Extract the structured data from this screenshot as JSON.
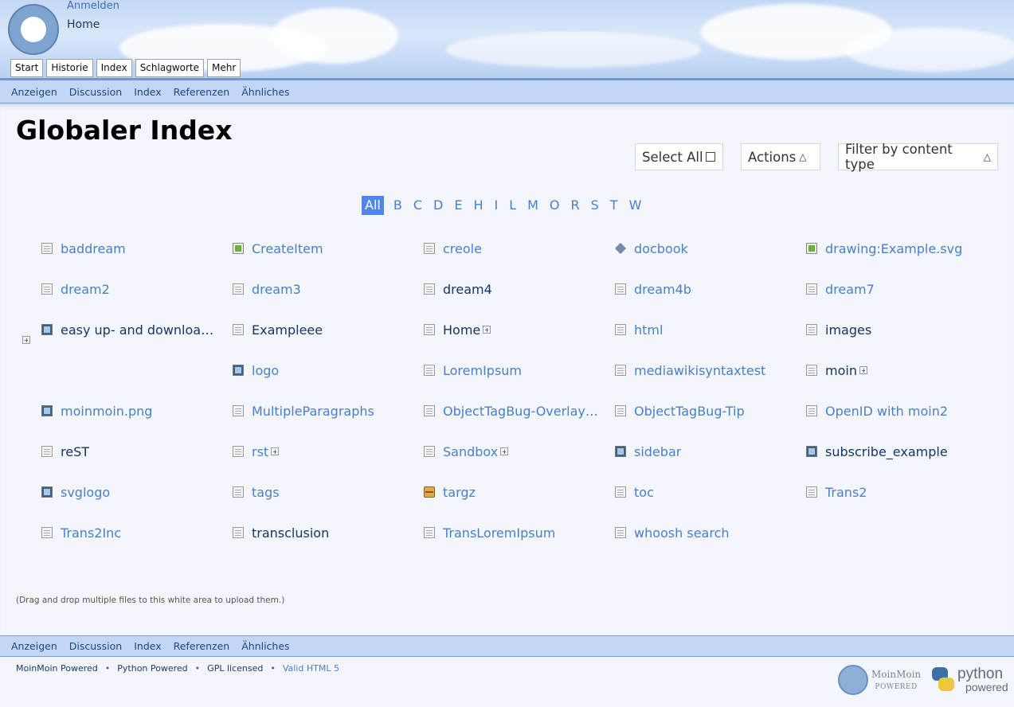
{
  "header": {
    "login_label": "Anmelden",
    "home_title": "Home",
    "buttons": [
      "Start",
      "Historie",
      "Index",
      "Schlagworte",
      "Mehr"
    ]
  },
  "subnav": [
    "Anzeigen",
    "Discussion",
    "Index",
    "Referenzen",
    "Ähnliches"
  ],
  "page": {
    "title": "Globaler Index",
    "select_all_label": "Select All",
    "actions_label": "Actions",
    "filter_label": "Filter by content type",
    "drag_hint": "(Drag and drop multiple files to this white area to upload them.)"
  },
  "alphabet": [
    "All",
    "B",
    "C",
    "D",
    "E",
    "H",
    "I",
    "L",
    "M",
    "O",
    "R",
    "S",
    "T",
    "W"
  ],
  "alphabet_active": "All",
  "items": [
    {
      "name": "baddream",
      "icon": "doc-icon",
      "kind": "doc",
      "visited": false,
      "expand": false
    },
    {
      "name": "CreateItem",
      "icon": "drawing-icon",
      "kind": "draw",
      "visited": false,
      "expand": false
    },
    {
      "name": "creole",
      "icon": "doc-icon",
      "kind": "doc",
      "visited": false,
      "expand": false
    },
    {
      "name": "docbook",
      "icon": "docbook-icon",
      "kind": "docbook",
      "visited": false,
      "expand": false
    },
    {
      "name": "drawing:Example.svg",
      "icon": "drawing-icon",
      "kind": "draw",
      "visited": false,
      "expand": false
    },
    {
      "name": "dream2",
      "icon": "doc-icon",
      "kind": "doc",
      "visited": false,
      "expand": false
    },
    {
      "name": "dream3",
      "icon": "doc-icon",
      "kind": "doc",
      "visited": false,
      "expand": false
    },
    {
      "name": "dream4",
      "icon": "doc-icon",
      "kind": "doc",
      "visited": true,
      "expand": false
    },
    {
      "name": "dream4b",
      "icon": "doc-icon",
      "kind": "doc",
      "visited": false,
      "expand": false
    },
    {
      "name": "dream7",
      "icon": "doc-icon",
      "kind": "doc",
      "visited": false,
      "expand": false
    },
    {
      "name": "easy up- and downloa…",
      "icon": "image-icon",
      "kind": "img",
      "visited": true,
      "expand": false
    },
    {
      "name": "Exampleee",
      "icon": "doc-icon",
      "kind": "doc",
      "visited": true,
      "expand": false
    },
    {
      "name": "Home",
      "icon": "doc-icon",
      "kind": "doc",
      "visited": true,
      "expand": true
    },
    {
      "name": "html",
      "icon": "doc-icon",
      "kind": "doc",
      "visited": false,
      "expand": false
    },
    {
      "name": "images",
      "icon": "doc-icon",
      "kind": "doc",
      "visited": true,
      "expand": false
    },
    {
      "name": "",
      "icon": "",
      "kind": "",
      "visited": false,
      "expand": false
    },
    {
      "name": "logo",
      "icon": "image-icon",
      "kind": "img",
      "visited": false,
      "expand": false
    },
    {
      "name": "LoremIpsum",
      "icon": "doc-icon",
      "kind": "doc",
      "visited": false,
      "expand": false
    },
    {
      "name": "mediawikisyntaxtest",
      "icon": "doc-icon",
      "kind": "doc",
      "visited": false,
      "expand": false
    },
    {
      "name": "moin",
      "icon": "doc-icon",
      "kind": "doc",
      "visited": true,
      "expand": true
    },
    {
      "name": "moinmoin.png",
      "icon": "image-icon",
      "kind": "img",
      "visited": false,
      "expand": false
    },
    {
      "name": "MultipleParagraphs",
      "icon": "doc-icon",
      "kind": "doc",
      "visited": false,
      "expand": false
    },
    {
      "name": "ObjectTagBug-Overlay…",
      "icon": "doc-icon",
      "kind": "doc",
      "visited": false,
      "expand": false
    },
    {
      "name": "ObjectTagBug-Tip",
      "icon": "doc-icon",
      "kind": "doc",
      "visited": false,
      "expand": false
    },
    {
      "name": "OpenID with moin2",
      "icon": "doc-icon",
      "kind": "doc",
      "visited": false,
      "expand": false
    },
    {
      "name": "reST",
      "icon": "doc-icon",
      "kind": "doc",
      "visited": true,
      "expand": false
    },
    {
      "name": "rst",
      "icon": "doc-icon",
      "kind": "doc",
      "visited": false,
      "expand": true
    },
    {
      "name": "Sandbox",
      "icon": "doc-icon",
      "kind": "doc",
      "visited": false,
      "expand": true
    },
    {
      "name": "sidebar",
      "icon": "image-icon",
      "kind": "img",
      "visited": false,
      "expand": false
    },
    {
      "name": "subscribe_example",
      "icon": "image-icon",
      "kind": "img",
      "visited": true,
      "expand": false
    },
    {
      "name": "svglogo",
      "icon": "image-icon",
      "kind": "img",
      "visited": false,
      "expand": false
    },
    {
      "name": "tags",
      "icon": "doc-icon",
      "kind": "doc",
      "visited": false,
      "expand": false
    },
    {
      "name": "targz",
      "icon": "archive-icon",
      "kind": "tar",
      "visited": false,
      "expand": false
    },
    {
      "name": "toc",
      "icon": "doc-icon",
      "kind": "doc",
      "visited": false,
      "expand": false
    },
    {
      "name": "Trans2",
      "icon": "doc-icon",
      "kind": "doc",
      "visited": false,
      "expand": false
    },
    {
      "name": "Trans2Inc",
      "icon": "doc-icon",
      "kind": "doc",
      "visited": false,
      "expand": false
    },
    {
      "name": "transclusion",
      "icon": "doc-icon",
      "kind": "doc",
      "visited": true,
      "expand": false
    },
    {
      "name": "TransLoremIpsum",
      "icon": "doc-icon",
      "kind": "doc",
      "visited": false,
      "expand": false
    },
    {
      "name": "whoosh search",
      "icon": "doc-icon",
      "kind": "doc",
      "visited": false,
      "expand": false
    }
  ],
  "footer": {
    "links": [
      "MoinMoin Powered",
      "Python Powered",
      "GPL licensed",
      "Valid HTML 5"
    ],
    "moin_badge_line1": "MoinMoin",
    "moin_badge_line2": "POWERED",
    "python_badge_line1": "python",
    "python_badge_line2": "powered"
  },
  "colors": {
    "link": "#4a7fc7",
    "visited_link": "#153563",
    "accent": "#4f86e8",
    "nav_bg": "#c3d6f6"
  }
}
